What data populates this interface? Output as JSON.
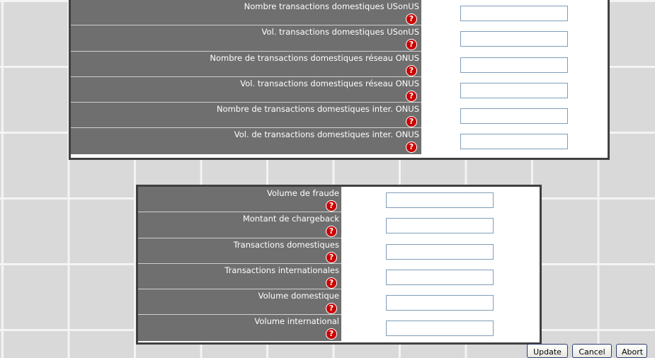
{
  "section_top": {
    "fields": [
      {
        "label": "Nombre transactions domestiques USonUS",
        "value": ""
      },
      {
        "label": "Vol. transactions domestiques USonUS",
        "value": ""
      },
      {
        "label": "Nombre de transactions domestiques réseau ONUS",
        "value": ""
      },
      {
        "label": "Vol. transactions domestiques réseau ONUS",
        "value": ""
      },
      {
        "label": "Nombre de transactions domestiques inter. ONUS",
        "value": ""
      },
      {
        "label": "Vol. de transactions domestiques inter. ONUS",
        "value": ""
      }
    ]
  },
  "section_bottom": {
    "fields": [
      {
        "label": "Volume de fraude",
        "value": ""
      },
      {
        "label": "Montant de chargeback",
        "value": ""
      },
      {
        "label": "Transactions domestiques",
        "value": ""
      },
      {
        "label": "Transactions internationales",
        "value": ""
      },
      {
        "label": "Volume domestique",
        "value": ""
      },
      {
        "label": "Volume international",
        "value": ""
      }
    ]
  },
  "help_icon": {
    "glyph": "?",
    "name": "help-icon",
    "color": "#cc0000"
  },
  "buttons": {
    "update": "Update",
    "cancel": "Cancel",
    "abort": "Abort"
  }
}
